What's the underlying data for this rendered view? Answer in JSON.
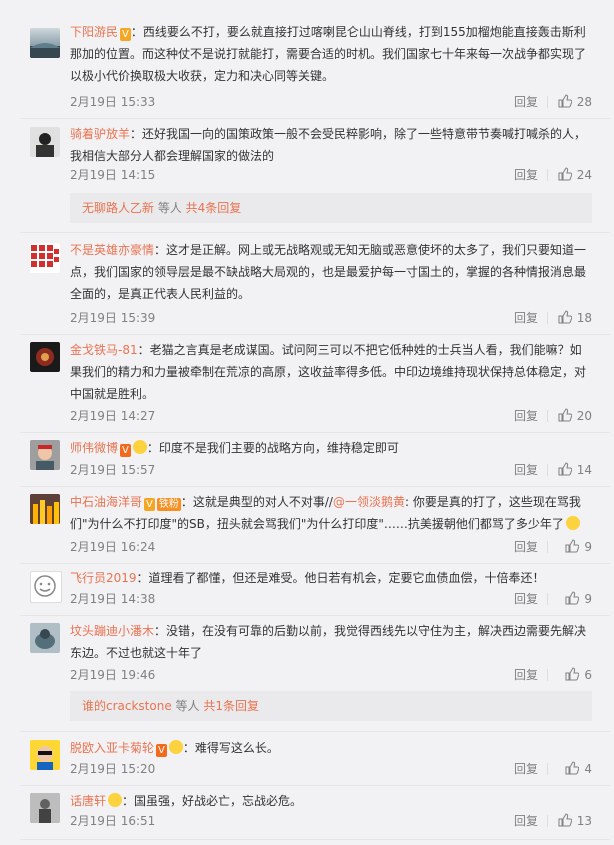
{
  "comments": [
    {
      "user": "下阳游民",
      "badges": [
        "V"
      ],
      "body": "：西线要么不打，要么就直接打过喀喇昆仑山山脊线，打到155加榴炮能直接轰击斯利那加的位置。而这种仗不是说打就能打，需要合适的时机。我们国家七十年来每一次战争都实现了以极小代价换取极大收获，定力和决心同等关键。",
      "time": "2月19日 15:33",
      "reply": "回复",
      "likes": "28"
    },
    {
      "user": "骑着驴放羊",
      "badges": [],
      "body": "：还好我国一向的国策政策一般不会受民粹影响，除了一些特意带节奏喊打喊杀的人，我相信大部分人都会理解国家的做法的",
      "time": "2月19日 14:15",
      "reply": "回复",
      "likes": "24"
    },
    {
      "user": "不是英雄亦豪情",
      "badges": [],
      "body": "：这才是正解。网上或无战略观或无知无脑或恶意使坏的太多了，我们只要知道一点，我们国家的领导层是最不缺战略大局观的，也是最爱护每一寸国土的，掌握的各种情报消息最全面的，是真正代表人民利益的。",
      "time": "2月19日 15:39",
      "reply": "回复",
      "likes": "18"
    },
    {
      "user": "金戈铁马-81",
      "badges": [],
      "body": "：老猫之言真是老成谋国。试问阿三可以不把它低种姓的士兵当人看，我们能嘛？如果我们的精力和力量被牵制在荒凉的高原，这收益率得多低。中印边境维持现状保持总体稳定，对中国就是胜利。",
      "time": "2月19日 14:27",
      "reply": "回复",
      "likes": "20"
    },
    {
      "user": "师伟微博",
      "badges": [
        "V"
      ],
      "body": "：印度不是我们主要的战略方向，维持稳定即可",
      "time": "2月19日 15:57",
      "reply": "回复",
      "likes": "14"
    },
    {
      "user": "中石油海洋哥",
      "badges": [
        "V",
        "铁粉"
      ],
      "mention": "@一领淡鹅黄",
      "body_pre": "：这就是典型的对人不对事//",
      "body": ": 你要是真的打了，这些现在骂我们\"为什么不打印度\"的SB，扭头就会骂我们\"为什么打印度\"……抗美援朝他们都骂了多少年了",
      "time": "2月19日 16:24",
      "reply": "回复",
      "likes": "9"
    },
    {
      "user": "飞行员2019",
      "badges": [],
      "body": "：道理看了都懂，但还是难受。他日若有机会，定要它血债血偿，十倍奉还！",
      "time": "2月19日 14:38",
      "reply": "回复",
      "likes": "9"
    },
    {
      "user": "坟头蹦迪小潘木",
      "badges": [],
      "body": "：没错，在没有可靠的后勤以前，我觉得西线先以守住为主，解决西边需要先解决东边。不过也就这十年了",
      "time": "2月19日 19:46",
      "reply": "回复",
      "likes": "6"
    },
    {
      "user": "脱欧入亚卡菊轮",
      "badges": [
        "V"
      ],
      "body": "：难得写这么长。",
      "time": "2月19日 15:20",
      "reply": "回复",
      "likes": "4"
    },
    {
      "user": "话唐轩",
      "badges": [],
      "body": "：国虽强，好战必亡，忘战必危。",
      "time": "2月19日 16:51",
      "reply": "回复",
      "likes": "13"
    }
  ],
  "more_replies": [
    {
      "who": "无聊路人乙新",
      "mid": " 等人 ",
      "count": "共4条回复"
    },
    {
      "who": "谁的crackstone",
      "mid": " 等人 ",
      "count": "共1条回复"
    }
  ],
  "colors": {
    "accent": "#eb7350",
    "meta": "#808080",
    "background": "#f2f2f5"
  }
}
